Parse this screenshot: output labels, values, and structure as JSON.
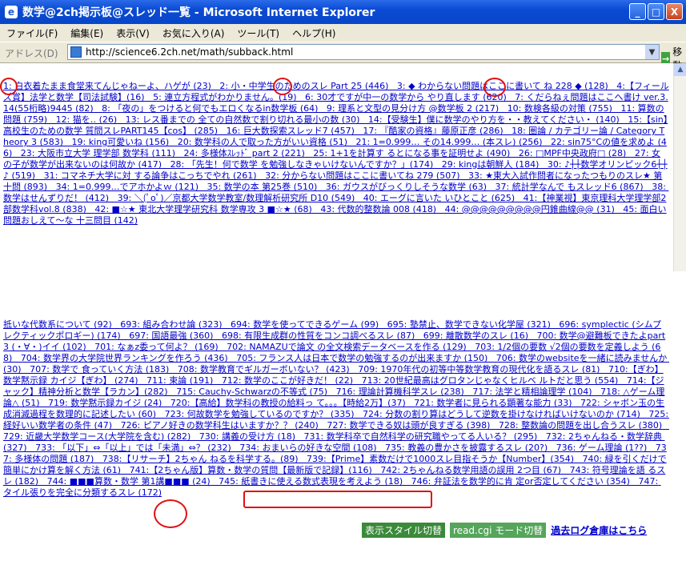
{
  "window": {
    "title": "数学@2ch掲示板@スレッド一覧 - Microsoft Internet Explorer",
    "min": "_",
    "max": "□",
    "close": "X"
  },
  "menu": [
    "ファイル(F)",
    "編集(E)",
    "表示(V)",
    "お気に入り(A)",
    "ツール(T)",
    "ヘルプ(H)"
  ],
  "address": {
    "label": "アドレス(D)",
    "url": "http://science6.2ch.net/math/subback.html",
    "go": "移動"
  },
  "threads_top": "1: 白衣着たまま食堂来てんじゃねーよ、ハゲが (23)   2: 小・中学生のためのスレ Part 25 (446)   3: ◆ わからない問題はここに書いて ね 228 ◆ (128)   4:【フィールズ賞】法学と数学【司法試験】(16)   5: 連立方程式がわかりません。(19)   6: 30才ですが中一の数学から やり直します (620)   7: くだらねぇ問題はここへ書け ver.3.14(55桁略)9445 (82)   8: 「夜の」をつけると何でもエロくなるin数学板 (64)   9: 理系と文型の見分け方 @数学板 2 (217)   10: 数検各級の対策 (755)   11: 算数の問題 (759)   12: 猫を‥ (26)   13: レス番までの 全ての自然数で割り切れる最小の数 (30)   14:【受験生】僕に数学のやり方を・・教えてください・ (140)   15:【sin】高校生のための数学 質問スレPART145【cos】 (285)   16: 巨大数探索スレッド7 (457)   17: 『酷家の資格』藤原正彦 (286)   18: 圏論 / カテゴリー論 / Category Theory 3 (583)   19: king可愛いね (156)   20: 数学科の人で取った方がいい資格 (51)   21: 1=0.999… その14.999… (本スレ) (256)   22: sin75°Cの値を求めよ (46)   23: 大阪市立大学 理学部 数学科 (111)   24: 多様体ｽﾚｯﾄﾞ part 2 (221)   25: 1+1を計算す るとになる事を証明せよ (490)   26: □MPF中央政府□ (28)   27: 女の子が数学が出来ないのは何故か (417)   28: 「先生！何で数学 を勉強しなきゃいけないんですか？」(174)   29: kingは朝鮮人 (184)   30: ♪┼┼数学オリンピック6┼┼♪ (519)   31: コマネチ大学に対 する論争はこっちでやれ (261)   32: 分からない問題はここに書いてね 279 (507)   33: ★東大入試作問者になったつもりのスレ★ 第十問 (893)   34: 1=0.999…でアホかよｗ (121)   35: 数学の本 第25巻 (510)   36: ガウスがびっくりしそうな数学 (63)   37: 統計学なんで もスレッド6 (867)   38: 数学はせんずりだ！ (412)   39: ＼(ﾟoﾟ)／京都大学数学教室/数理解析研究所 D10 (549)   40: エーグに言いた いひとこと (625)   41:【神業視】東京理科大学理学部2部数学科vol.8 (838)   42: ■☆★ 東北大学理学研究科 数学専攻 3 ■☆★ (68)   43: 代数的整数論 008 (418)   44: @@@@@@@@@円錐曲線@@ (31)   45: 面白い問題おしえて～な 十三問目 (142)",
  "threads_bottom": "抵いな代数系について (92)   693: 組み合わせ論 (323)   694: 数学を使ってできるゲーム (99)   695: 塾禁止、数学できない化学屋 (321)   696: symplectic (シムプレクティックポロギー) (174)   697: 国語最強 (360)   698: 有限生成群の性質をコンコ調べるスレ (87)   699: 離散数学のスレ (16)   700: 数学@避難板できたよpart3 (・∀・)イイ (102)   701: なぁz委って何よ？ (169)   702: NAMAZUで論文 の全文検索データベースを作る (129)   703: 1/2個の要数 √2個の要数を定義しよう (68)   704: 数学界の大学院世界ランキングを作ろう (436)   705: フランス人は日本で数学の勉強するのが出来ますか (150)   706: 数学のwebsiteを一緒に読みませんか (30)   707: 数学で 食っていく方法 (183)   708: 数学教育でギルガーボいない？ (423)   709: 1970年代の初等中等数学教育の現代化を語るスレ (81)   710:【ぎわ】数学黙示録 カイジ【ぎわ】 (274)   711: 束論 (191)   712: 数学のここが好きだ！ (22)   713: 20世紀最高はグロタンじゃなくヒルベ ルトだと思う (554)   714:【ジャック】精神分析と数学【ラカン】(282)   715: Cauchy-Schwarzの不等式 (75)   716: 理論計算機科学スレ (238)   717: 法学と精相論理学 (104)   718: △ゲーム理論△ (51)   719: 数学黙示録カイジ (24)   720:【高給】数学科の教授の給料っ て。。。【時給2万】(37)   721: 数学者に見られる顕著な能力 (33)   722: シャボン玉の生成消滅過程を数理的に記述したい (60)   723: 何故数学を勉強しているのですか？ (335)   724: 分数の割り算はどうして逆数を掛けなければいけないのか (714)   725: 経好いい数学者の条件 (47)   726: ピアノ好きの数学科生はいますか？？ (240)   727: 数学できる奴は頭が良すぎる (398)   728: 整数論の問題を出し合うスレ (380)   729: 近畿大学数学コース(大学院を含む) (282)   730: 講義の受け方 (18)   731: 数学科卒で自然科学の研究職やってる人いる？ (295)   732: 2ちゃんねる・数学辞典 (327)   733: 「以下」⇔「以上」では「未満」⇔？ (232)   734: おまいらの好きな空間 (108)   735: 教義の豊かさを披露するスレ (20?)   736: ゲーム理論 (1??)   737: 多様体の問題 (187)   738:【リサーチ】2ちゃん ねるを科学する。(89)   739:【Prime】素数だけで1000スレ目指そうか【Number】(354)   740: 緑を引くだけで簡単にかけ算を解く方法 (61)   741:【2ちゃん版】算数・数学の質問【最新版で記録】(116)   742: 2ちゃんねる数学用語の誤用 2つ目 (67)   743: 符号理論を語 るスレ (182)   744: ■■■算数・数学 第1講■■■ (24)   745: 紙書きに使える数式表現を考えよう (18)   746: 弁証法を数学的に肯 定or否定してください (354)   747: タイル張りを完全に分類するスレ (172)",
  "footer": {
    "style_btn": "表示スタイル切替",
    "readcgi_btn": "read.cgi モード切替",
    "log_link": "過去ログ倉庫はこちら"
  }
}
